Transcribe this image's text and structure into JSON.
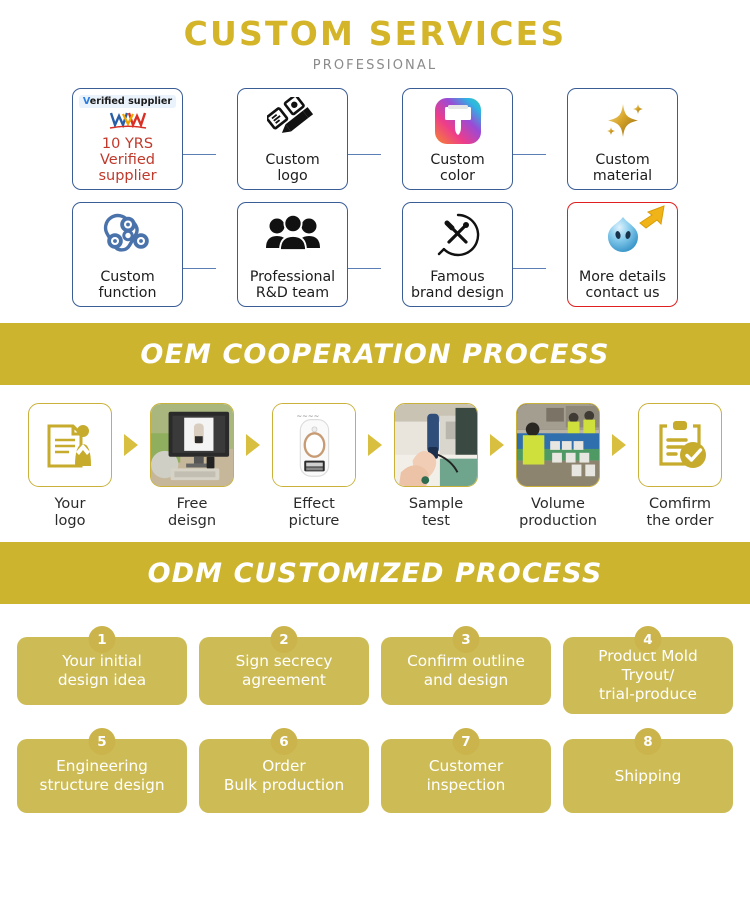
{
  "header": {
    "title": "CUSTOM SERVICES",
    "subtitle": "PROFESSIONAL",
    "title_color": "#d4b428",
    "subtitle_color": "#8a8a8a"
  },
  "features": {
    "row1": [
      {
        "icon": "verified-supplier-badge-icon",
        "badge_prefix": "V",
        "badge_text": "erified supplier",
        "label": "10 YRS\nVerified\nsupplier",
        "text_color": "#c0392b",
        "border_color": "#3a5d96",
        "special": "verified"
      },
      {
        "icon": "pencil-ruler-icon",
        "label": "Custom\nlogo",
        "border_color": "#3a5d96"
      },
      {
        "icon": "paint-brush-icon",
        "label": "Custom\ncolor",
        "border_color": "#3a5d96"
      },
      {
        "icon": "sparkle-star-icon",
        "label": "Custom\nmaterial",
        "border_color": "#3a5d96"
      }
    ],
    "row2": [
      {
        "icon": "fidget-spinner-icon",
        "label": "Custom\nfunction",
        "border_color": "#3a5d96"
      },
      {
        "icon": "people-group-icon",
        "label": "Professional\nR&D team",
        "border_color": "#3a5d96"
      },
      {
        "icon": "tools-circle-icon",
        "label": "Famous\nbrand design",
        "border_color": "#3a5d96"
      },
      {
        "icon": "chat-bubble-face-icon",
        "arrow_icon": "yellow-arrow-icon",
        "label": "More details\ncontact us",
        "border_color": "#e02020",
        "special": "alert"
      }
    ]
  },
  "oem": {
    "banner": "OEM COOPERATION PROCESS",
    "banner_color": "#cdb42e",
    "steps": [
      {
        "icon": "document-person-icon",
        "label": "Your\nlogo",
        "type": "icon"
      },
      {
        "icon": "monitor-design-photo",
        "label": "Free\ndeisgn",
        "type": "photo"
      },
      {
        "icon": "ipl-device-photo",
        "label": "Effect\npicture",
        "type": "photo"
      },
      {
        "icon": "sample-test-photo",
        "label": "Sample\ntest",
        "type": "photo"
      },
      {
        "icon": "assembly-line-photo",
        "label": "Volume\nproduction",
        "type": "photo"
      },
      {
        "icon": "clipboard-check-icon",
        "label": "Comfirm\nthe order",
        "type": "icon"
      }
    ],
    "arrow_icon": "right-triangle-arrow-icon",
    "arrow_color": "#d8bf3f"
  },
  "odm": {
    "banner": "ODM CUSTOMIZED PROCESS",
    "banner_color": "#cdb42e",
    "card_color": "#cdbc56",
    "badge_color": "#cbb44c",
    "cards": [
      {
        "number": "1",
        "text": "Your initial\ndesign idea"
      },
      {
        "number": "2",
        "text": "Sign secrecy\nagreement"
      },
      {
        "number": "3",
        "text": "Confirm outline\nand design"
      },
      {
        "number": "4",
        "text": "Product Mold\nTryout/\ntrial-produce"
      },
      {
        "number": "5",
        "text": "Engineering\nstructure design"
      },
      {
        "number": "6",
        "text": "Order\nBulk production"
      },
      {
        "number": "7",
        "text": "Customer\ninspection"
      },
      {
        "number": "8",
        "text": "Shipping"
      }
    ]
  }
}
